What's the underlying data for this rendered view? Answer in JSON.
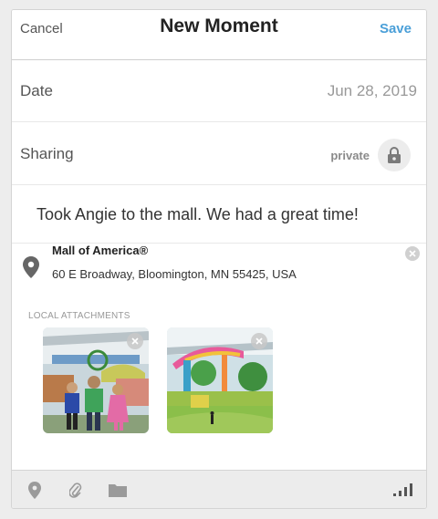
{
  "header": {
    "cancel_label": "Cancel",
    "title": "New Moment",
    "save_label": "Save"
  },
  "date_row": {
    "label": "Date",
    "value": "Jun 28, 2019"
  },
  "sharing_row": {
    "label": "Sharing",
    "value": "private",
    "icon": "lock-icon"
  },
  "note": {
    "text": "Took Angie to the mall. We had a great time!"
  },
  "location": {
    "name": "Mall of America®",
    "address": "60 E Broadway, Bloomington, MN 55425, USA",
    "icon": "map-pin-icon"
  },
  "attachments": {
    "section_label": "LOCAL ATTACHMENTS",
    "items": [
      {
        "description": "photo-family-at-mall"
      },
      {
        "description": "photo-amusement-park"
      }
    ]
  },
  "toolbar": {
    "icons": [
      "location-pin-icon",
      "paperclip-icon",
      "folder-icon"
    ],
    "signal_icon": "signal-strength-icon"
  },
  "colors": {
    "accent": "#4a9fd8",
    "text_primary": "#222222",
    "text_muted": "#999999",
    "background": "#ededed"
  }
}
